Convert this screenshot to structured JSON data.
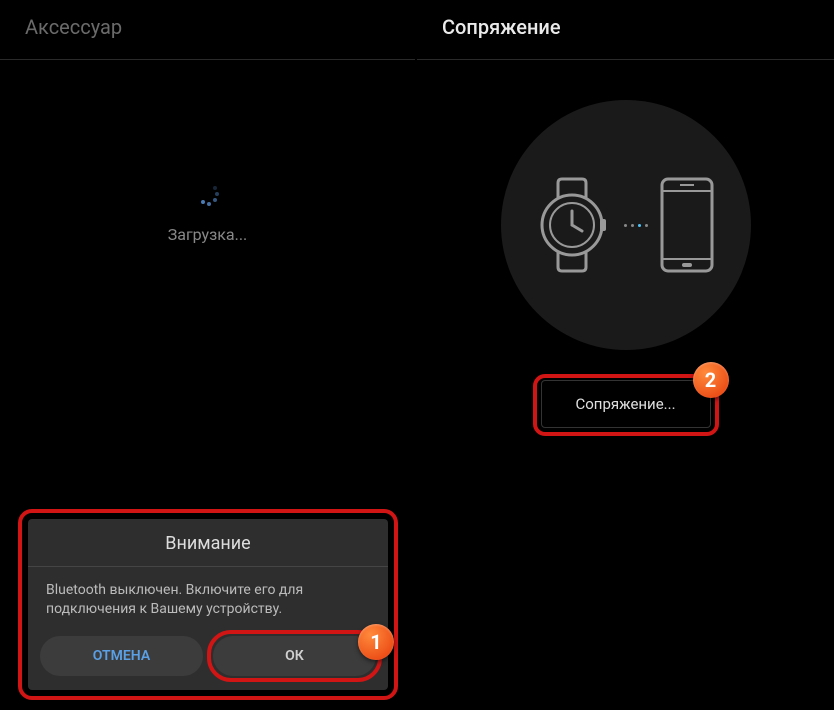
{
  "left": {
    "title": "Аксессуар",
    "loading": "Загрузка..."
  },
  "right": {
    "title": "Сопряжение",
    "pair_button": "Сопряжение..."
  },
  "dialog": {
    "title": "Внимание",
    "message": "Bluetooth выключен. Включите его для подключения к Вашему устройству.",
    "cancel": "ОТМЕНА",
    "ok": "ОК"
  },
  "annotations": {
    "badge1": "1",
    "badge2": "2"
  }
}
